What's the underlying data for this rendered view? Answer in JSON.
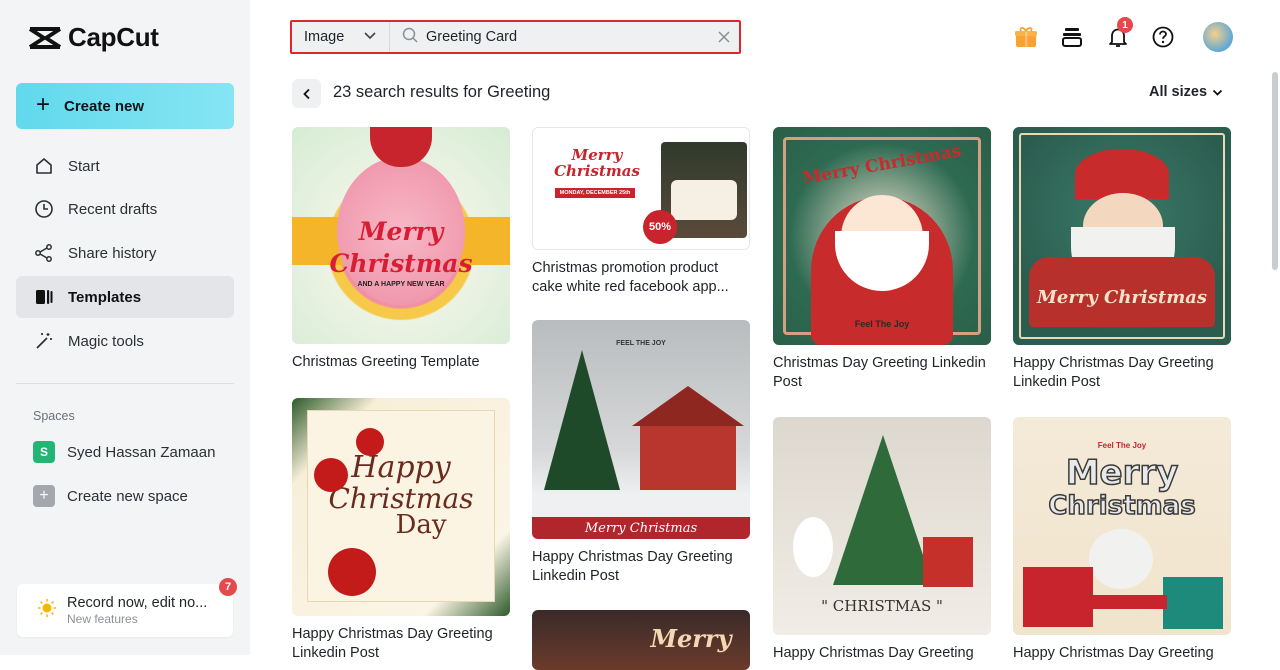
{
  "app": {
    "name": "CapCut"
  },
  "sidebar": {
    "create_label": "Create new",
    "items": [
      {
        "label": "Start",
        "icon": "home-icon"
      },
      {
        "label": "Recent drafts",
        "icon": "clock-icon"
      },
      {
        "label": "Share history",
        "icon": "share-icon"
      },
      {
        "label": "Templates",
        "icon": "templates-icon"
      },
      {
        "label": "Magic tools",
        "icon": "magic-wand-icon"
      }
    ],
    "spaces_label": "Spaces",
    "space_initial": "S",
    "space_name": "Syed Hassan Zamaan",
    "create_space_label": "Create new space",
    "record_title": "Record now, edit no...",
    "record_sub": "New features",
    "record_badge": "7"
  },
  "search": {
    "type": "Image",
    "query": "Greeting Card"
  },
  "topbar": {
    "notification_count": "1"
  },
  "results": {
    "title": "23 search results for Greeting",
    "sizes_label": "All sizes"
  },
  "cards": [
    {
      "title": "Christmas Greeting Template",
      "thumb_line1": "Merry",
      "thumb_line2": "Christmas",
      "thumb_line3": "AND A HAPPY NEW YEAR"
    },
    {
      "title": "Christmas promotion product cake white red facebook app...",
      "thumb_line1": "Merry",
      "thumb_line2": "Christmas",
      "thumb_line3": "MONDAY, DECEMBER 25th",
      "thumb_badge": "50%"
    },
    {
      "title": "Christmas Day Greeting Linkedin Post",
      "thumb_line1": "Merry Christmas",
      "thumb_line3": "Feel The Joy"
    },
    {
      "title": "Happy Christmas Day Greeting Linkedin Post",
      "thumb_line1": "Merry Christmas"
    },
    {
      "title": "Happy Christmas Day Greeting Linkedin Post",
      "thumb_line1": "Happy",
      "thumb_line2": "Christmas",
      "thumb_line3": "Day"
    },
    {
      "title": "Happy Christmas Day Greeting Linkedin Post",
      "thumb_line1": "Merry Christmas",
      "thumb_line3": "FEEL THE JOY"
    },
    {
      "title": "Happy Christmas Day Greeting",
      "thumb_line1": "\" CHRISTMAS \""
    },
    {
      "title": "Happy Christmas Day Greeting",
      "thumb_line1": "Merry",
      "thumb_line2": "Christmas",
      "thumb_line3": "Feel The Joy"
    },
    {
      "thumb_line1": "Merry"
    }
  ]
}
